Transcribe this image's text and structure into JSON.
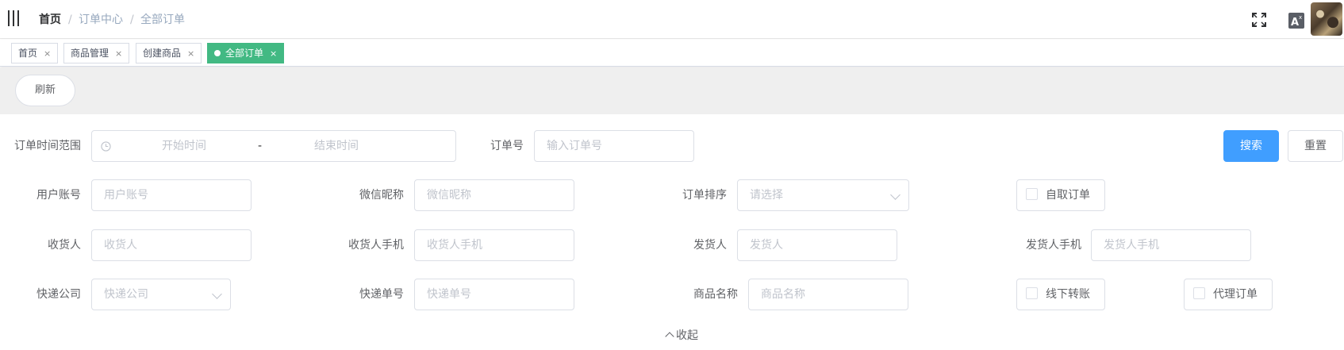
{
  "navbar": {
    "breadcrumb": [
      {
        "label": "首页"
      },
      {
        "label": "订单中心"
      },
      {
        "label": "全部订单"
      }
    ],
    "separator": "/"
  },
  "tags": [
    {
      "label": "首页",
      "close": "×"
    },
    {
      "label": "商品管理",
      "close": "×"
    },
    {
      "label": "创建商品",
      "close": "×"
    },
    {
      "label": "全部订单",
      "close": "×",
      "active": true
    }
  ],
  "toolbar": {
    "refresh_label": "刷新"
  },
  "filters": {
    "time_range": {
      "label": "订单时间范围",
      "start_placeholder": "开始时间",
      "separator": "-",
      "end_placeholder": "结束时间"
    },
    "order_no": {
      "label": "订单号",
      "placeholder": "输入订单号"
    },
    "user_account": {
      "label": "用户账号",
      "placeholder": "用户账号"
    },
    "wechat_nick": {
      "label": "微信昵称",
      "placeholder": "微信昵称"
    },
    "order_sort": {
      "label": "订单排序",
      "placeholder": "请选择"
    },
    "self_pickup": {
      "label": "自取订单"
    },
    "receiver": {
      "label": "收货人",
      "placeholder": "收货人"
    },
    "receiver_phone": {
      "label": "收货人手机",
      "placeholder": "收货人手机"
    },
    "sender": {
      "label": "发货人",
      "placeholder": "发货人"
    },
    "sender_phone": {
      "label": "发货人手机",
      "placeholder": "发货人手机"
    },
    "express_company": {
      "label": "快递公司",
      "placeholder": "快递公司"
    },
    "express_no": {
      "label": "快递单号",
      "placeholder": "快递单号"
    },
    "product_name": {
      "label": "商品名称",
      "placeholder": "商品名称"
    },
    "offline_transfer": {
      "label": "线下转账"
    },
    "agent_order": {
      "label": "代理订单"
    },
    "search_label": "搜索",
    "reset_label": "重置",
    "collapse_label": "收起"
  },
  "colors": {
    "primary": "#409eff",
    "active_tag": "#42b983"
  }
}
